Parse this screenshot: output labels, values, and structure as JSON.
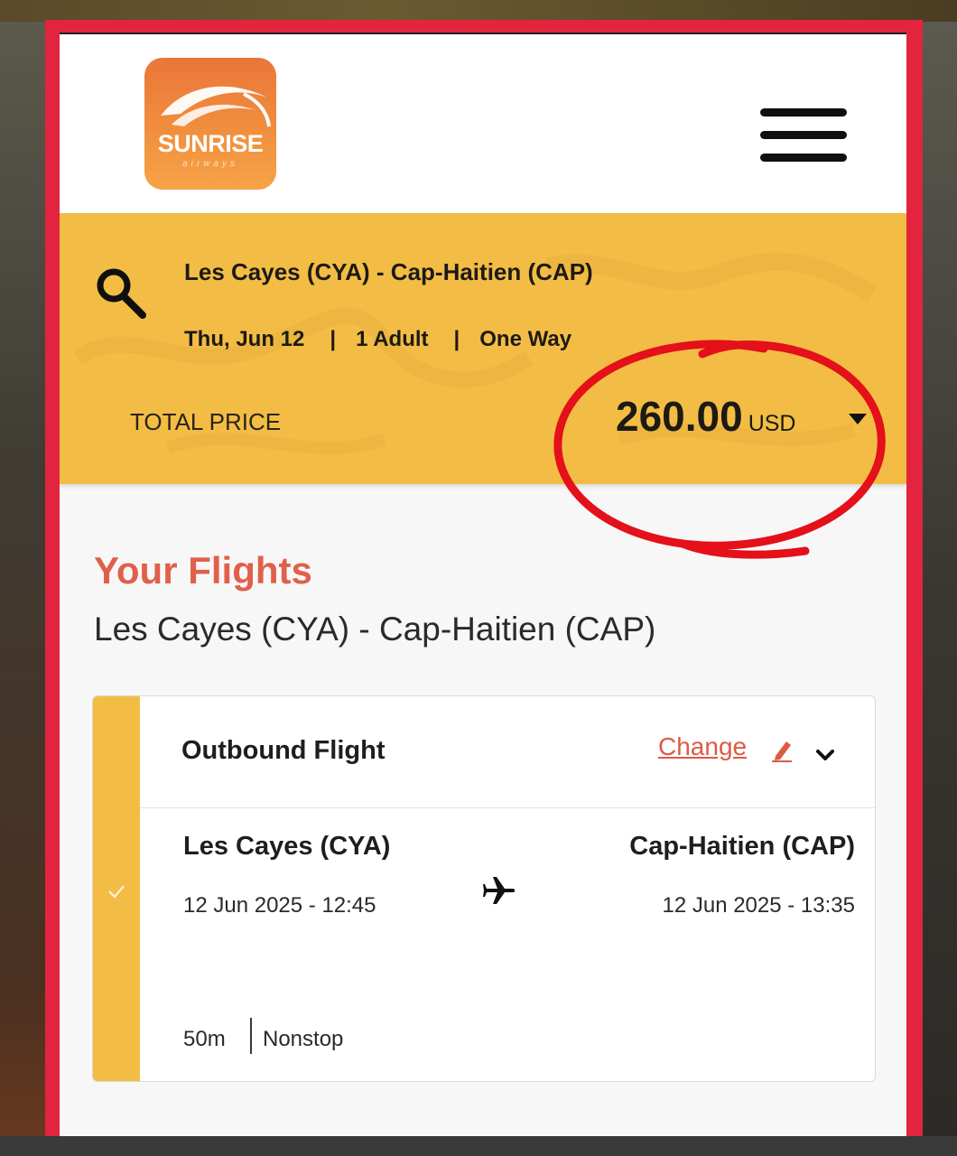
{
  "brand": {
    "name": "SUNRISE",
    "tagline": "airways"
  },
  "search": {
    "route": "Les Cayes (CYA) - Cap-Haitien (CAP)",
    "date": "Thu, Jun 12",
    "passengers": "1 Adult",
    "trip_type": "One Way",
    "separator": "|",
    "total_label": "TOTAL PRICE",
    "total_amount": "260.00",
    "currency": "USD"
  },
  "flights": {
    "title": "Your Flights",
    "route": "Les Cayes (CYA) - Cap-Haitien (CAP)",
    "outbound": {
      "title": "Outbound Flight",
      "change_label": "Change",
      "departure_city": "Les Cayes (CYA)",
      "departure_time": "12 Jun 2025 - 12:45",
      "arrival_city": "Cap-Haitien (CAP)",
      "arrival_time": "12 Jun 2025 - 13:35",
      "duration": "50m",
      "stops": "Nonstop"
    }
  },
  "colors": {
    "accent_yellow": "#f3bd45",
    "brand_orange": "#f08a3c",
    "title_coral": "#e0604a",
    "annotation_red": "#e4101a",
    "frame_red": "#e3243f"
  },
  "icons": [
    "menu-icon",
    "search-icon",
    "caret-down-icon",
    "pencil-icon",
    "chevron-down-icon",
    "plane-icon",
    "check-icon"
  ]
}
